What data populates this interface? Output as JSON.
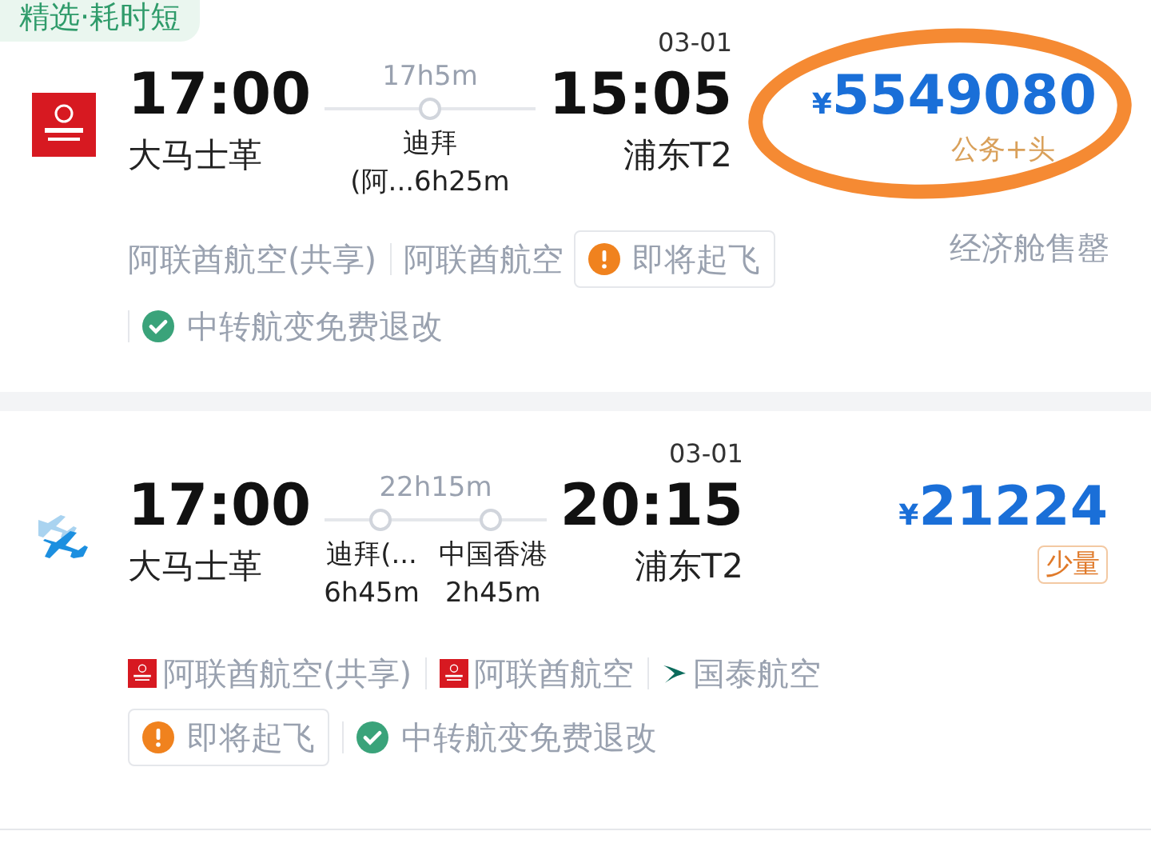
{
  "flights": [
    {
      "tag": "精选·耗时短",
      "kind": "emirates",
      "depart_time": "17:00",
      "depart_airport": "大马士革",
      "duration": "17h5m",
      "stops": [
        {
          "city": "迪拜",
          "layover": "(阿...6h25m"
        }
      ],
      "arrive_date": "03-01",
      "arrive_time": "15:05",
      "arrive_airport": "浦东T2",
      "currency": "¥",
      "price": "5549080",
      "circled": true,
      "fare_note": {
        "kind": "text",
        "text": "公务+头"
      },
      "info_rows": [
        [
          {
            "kind": "carrier",
            "text": "阿联酋航空(共享)"
          },
          {
            "kind": "carrier",
            "text": "阿联酋航空"
          },
          {
            "kind": "warning",
            "text": "即将起飞"
          }
        ],
        [
          {
            "kind": "ok",
            "text": "中转航变免费退改"
          }
        ]
      ],
      "cabin_note": "经济舱售罄"
    },
    {
      "kind": "multi-airline",
      "depart_time": "17:00",
      "depart_airport": "大马士革",
      "duration": "22h15m",
      "stops": [
        {
          "city": "迪拜(...",
          "layover": "6h45m"
        },
        {
          "city": "中国香港",
          "layover": "2h45m"
        }
      ],
      "arrive_date": "03-01",
      "arrive_time": "20:15",
      "arrive_airport": "浦东T2",
      "currency": "¥",
      "price": "21224",
      "circled": false,
      "fare_note": {
        "kind": "tag",
        "text": "少量"
      },
      "info_rows": [
        [
          {
            "kind": "emirates-carrier",
            "text": "阿联酋航空(共享)"
          },
          {
            "kind": "emirates-carrier",
            "text": "阿联酋航空"
          },
          {
            "kind": "cathay-carrier",
            "text": "国泰航空"
          }
        ],
        [
          {
            "kind": "warning",
            "text": "即将起飞"
          },
          {
            "kind": "ok",
            "text": "中转航变免费退改"
          }
        ]
      ]
    }
  ]
}
